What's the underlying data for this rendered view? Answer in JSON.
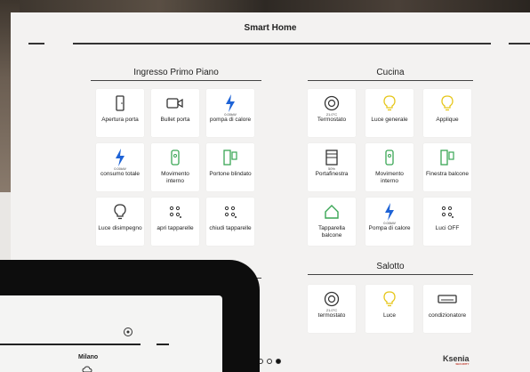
{
  "app": {
    "title": "Smart Home"
  },
  "sections": [
    {
      "title": "Ingresso Primo Piano",
      "tiles": [
        {
          "label": "Apertura porta",
          "value": "",
          "icon": "door-icon",
          "color": "#333333"
        },
        {
          "label": "Bullet porta",
          "value": "",
          "icon": "camera-icon",
          "color": "#333333"
        },
        {
          "label": "pompa di calore",
          "value": "0.00kW",
          "icon": "lightning-icon",
          "color": "#1e63d6"
        },
        {
          "label": "consumo totale",
          "value": "0.00kW",
          "icon": "lightning-icon",
          "color": "#1e63d6"
        },
        {
          "label": "Movimento interno",
          "value": "",
          "icon": "motion-sensor-icon",
          "color": "#3aa655"
        },
        {
          "label": "Portone blindato",
          "value": "",
          "icon": "door-contact-icon",
          "color": "#3aa655"
        },
        {
          "label": "Luce disimpegno",
          "value": "",
          "icon": "bulb-icon",
          "color": "#333333"
        },
        {
          "label": "apri tapparelle",
          "value": "",
          "icon": "scenario-icon",
          "color": "#333333"
        },
        {
          "label": "chiudi tapparelle",
          "value": "",
          "icon": "scenario-icon",
          "color": "#333333"
        }
      ]
    },
    {
      "title": "Cucina",
      "tiles": [
        {
          "label": "Termostato",
          "value": "21.0°C",
          "icon": "thermostat-icon",
          "color": "#333333"
        },
        {
          "label": "Luce generale",
          "value": "",
          "icon": "bulb-icon",
          "color": "#e6c619"
        },
        {
          "label": "Applique",
          "value": "",
          "icon": "bulb-icon",
          "color": "#e6c619"
        },
        {
          "label": "Portafinestra",
          "value": "50%",
          "icon": "shutter-icon",
          "color": "#333333"
        },
        {
          "label": "Movimento interno",
          "value": "",
          "icon": "motion-sensor-icon",
          "color": "#3aa655"
        },
        {
          "label": "Finestra balcone",
          "value": "",
          "icon": "door-contact-icon",
          "color": "#3aa655"
        },
        {
          "label": "Tapparella balcone",
          "value": "",
          "icon": "house-icon",
          "color": "#3aa655"
        },
        {
          "label": "Pompa di calore",
          "value": "0.00kW",
          "icon": "lightning-icon",
          "color": "#1e63d6"
        },
        {
          "label": "Luci OFF",
          "value": "",
          "icon": "scenario-icon",
          "color": "#333333"
        }
      ]
    },
    {
      "title": "Salotto",
      "tiles": [
        {
          "label": "termostato",
          "value": "21.0°C",
          "icon": "thermostat-icon",
          "color": "#333333"
        },
        {
          "label": "Luce",
          "value": "",
          "icon": "bulb-icon",
          "color": "#e6c619"
        },
        {
          "label": "condizionatore",
          "value": "",
          "icon": "air-conditioner-icon",
          "color": "#333333"
        }
      ]
    }
  ],
  "pager": {
    "pages": 3,
    "active": 3
  },
  "brand": {
    "name": "Ksenia",
    "tagline": "SECURITY"
  },
  "tablet": {
    "city": "Milano"
  }
}
